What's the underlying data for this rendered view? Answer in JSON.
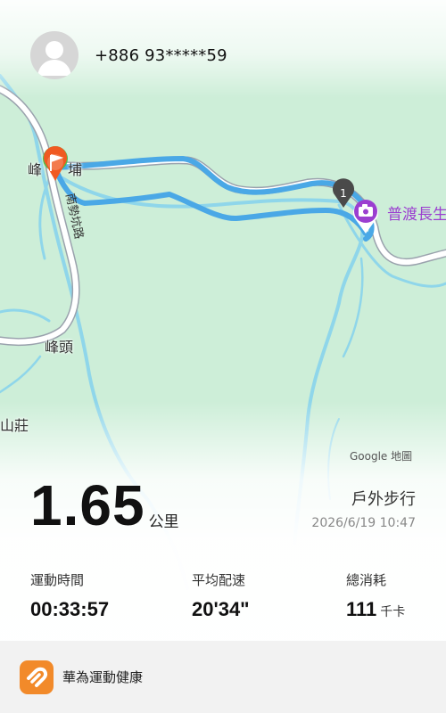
{
  "header": {
    "phone": "+886 93*****59"
  },
  "map": {
    "labels": {
      "place_top": "峰",
      "place_top_right": "埔",
      "road": "南勢坑路",
      "village": "峰頭",
      "mountain": "山莊",
      "poi": "普渡長生",
      "marker_number": "1"
    },
    "attribution": "Google 地圖"
  },
  "summary": {
    "distance": "1.65",
    "distance_unit": "公里",
    "activity_type": "戶外步行",
    "datetime": "2026/6/19 10:47"
  },
  "stats": [
    {
      "label": "運動時間",
      "value": "00:33:57",
      "unit": ""
    },
    {
      "label": "平均配速",
      "value": "20'34\"",
      "unit": ""
    },
    {
      "label": "總消耗",
      "value": "111",
      "unit": "千卡"
    }
  ],
  "app_bar": {
    "name": "華為運動健康"
  },
  "colors": {
    "route": "#4aa8e6",
    "map_bg": "#cdeed8",
    "river": "#8fd6ea",
    "road": "#b9bfc8",
    "start_marker": "#f05a22",
    "poi": "#9b3fd0",
    "app_icon": "#f28a2a"
  }
}
